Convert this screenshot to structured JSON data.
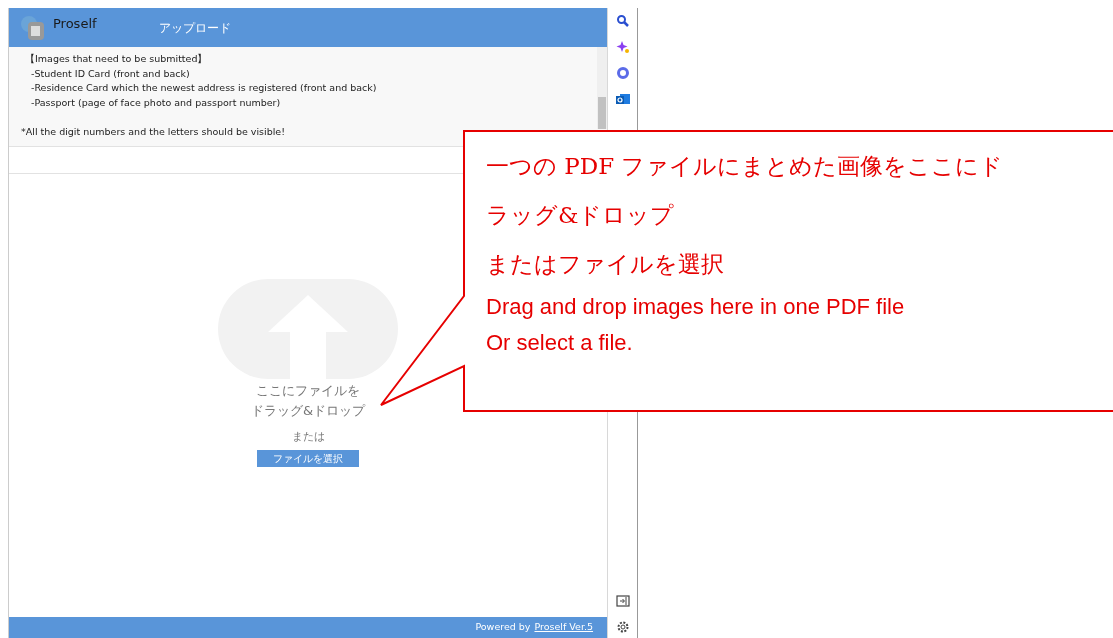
{
  "app": {
    "logo_text": "Proself",
    "title": "アップロード"
  },
  "instructions": {
    "heading": "【Images that need to be submitted】",
    "items": [
      "-Student ID Card (front and back)",
      "-Residence Card which the newest address is registered (front and back)",
      "-Passport (page of face photo and passport number)"
    ],
    "note": "*All the digit numbers and the letters should be visible!"
  },
  "dropzone": {
    "lines": [
      "ここにファイルを",
      "ドラッグ&ドロップ"
    ],
    "or": "または",
    "button": "ファイルを選択"
  },
  "footer": {
    "prefix": "Powered by",
    "link": "Proself Ver.5"
  },
  "callout": {
    "ja_lines": [
      "一つの PDF ファイルにまとめた画像をここにド",
      "ラッグ&ドロップ",
      "またはファイルを選択"
    ],
    "en_lines": [
      "Drag and drop images here in one PDF file",
      "Or select a file."
    ]
  }
}
